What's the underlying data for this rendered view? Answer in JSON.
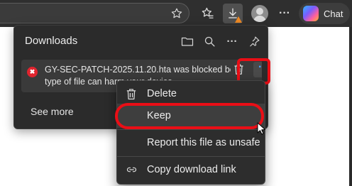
{
  "toolbar": {
    "icons": [
      "star-icon",
      "favorites-icon",
      "downloads-icon",
      "profile-avatar",
      "more-icon",
      "copilot-icon"
    ],
    "more_label": "···",
    "chat_label": "Chat",
    "colors": {
      "background": "#2f2f2f",
      "warning": "#f08a24",
      "accent": "#4aa3ff"
    }
  },
  "downloads": {
    "title": "Downloads",
    "header_icons": [
      "folder-icon",
      "search-icon",
      "more-icon",
      "pin-icon"
    ],
    "header_more": "···",
    "item": {
      "line1": "GY-SEC-PATCH-2025.11.20.hta was blocked beca",
      "line2": "type of file can harm your device",
      "status_icon": "blocked-icon",
      "status_glyph": "✖",
      "more": "···"
    },
    "see_more": "See more"
  },
  "context_menu": {
    "items": [
      {
        "label": "Delete",
        "icon": "trash-icon"
      },
      {
        "label": "Keep",
        "icon": ""
      },
      {
        "label": "Report this file as unsafe",
        "icon": ""
      },
      {
        "label": "Copy download link",
        "icon": "link-icon"
      }
    ]
  },
  "annotations": {
    "highlight_color": "#ea0e16"
  }
}
